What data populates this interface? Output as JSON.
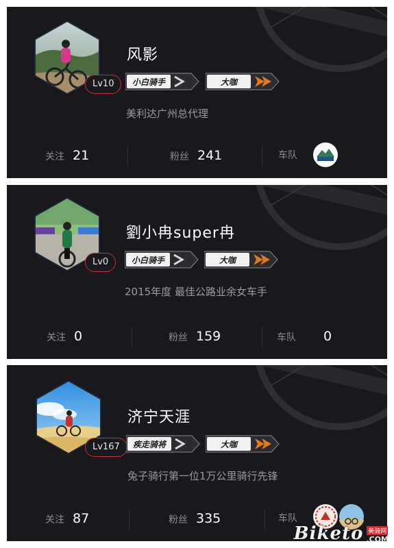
{
  "profiles": [
    {
      "name": "风影",
      "level": "Lv10",
      "badge1": "小白骑手",
      "badge2": "大咖",
      "description": "美利达广州总代理",
      "follow_label": "关注",
      "follow_count": "21",
      "fans_label": "粉丝",
      "fans_count": "241",
      "team_label": "车队",
      "team_icon": "team-logo-icon"
    },
    {
      "name": "劉小冉super冉",
      "level": "Lv0",
      "badge1": "小白骑手",
      "badge2": "大咖",
      "description": "2015年度 最佳公路业余女车手",
      "follow_label": "关注",
      "follow_count": "0",
      "fans_label": "粉丝",
      "fans_count": "159",
      "team_label": "车队",
      "team_count": "0"
    },
    {
      "name": "济宁天涯",
      "level": "Lv167",
      "badge1": "疾走骑将",
      "badge2": "大咖",
      "description": "兔子骑行第一位1万公里骑行先锋",
      "follow_label": "关注",
      "follow_count": "87",
      "fans_label": "粉丝",
      "fans_count": "335",
      "team_label": "车队",
      "team_icon": "team-logo-icon"
    }
  ],
  "watermark": {
    "text": "Biketo",
    "cn": "美骑网",
    "com": ".COM"
  },
  "colors": {
    "card_bg": "#19191d",
    "level_border": "#c0343a",
    "badge_arrow": "#e07a1f"
  }
}
